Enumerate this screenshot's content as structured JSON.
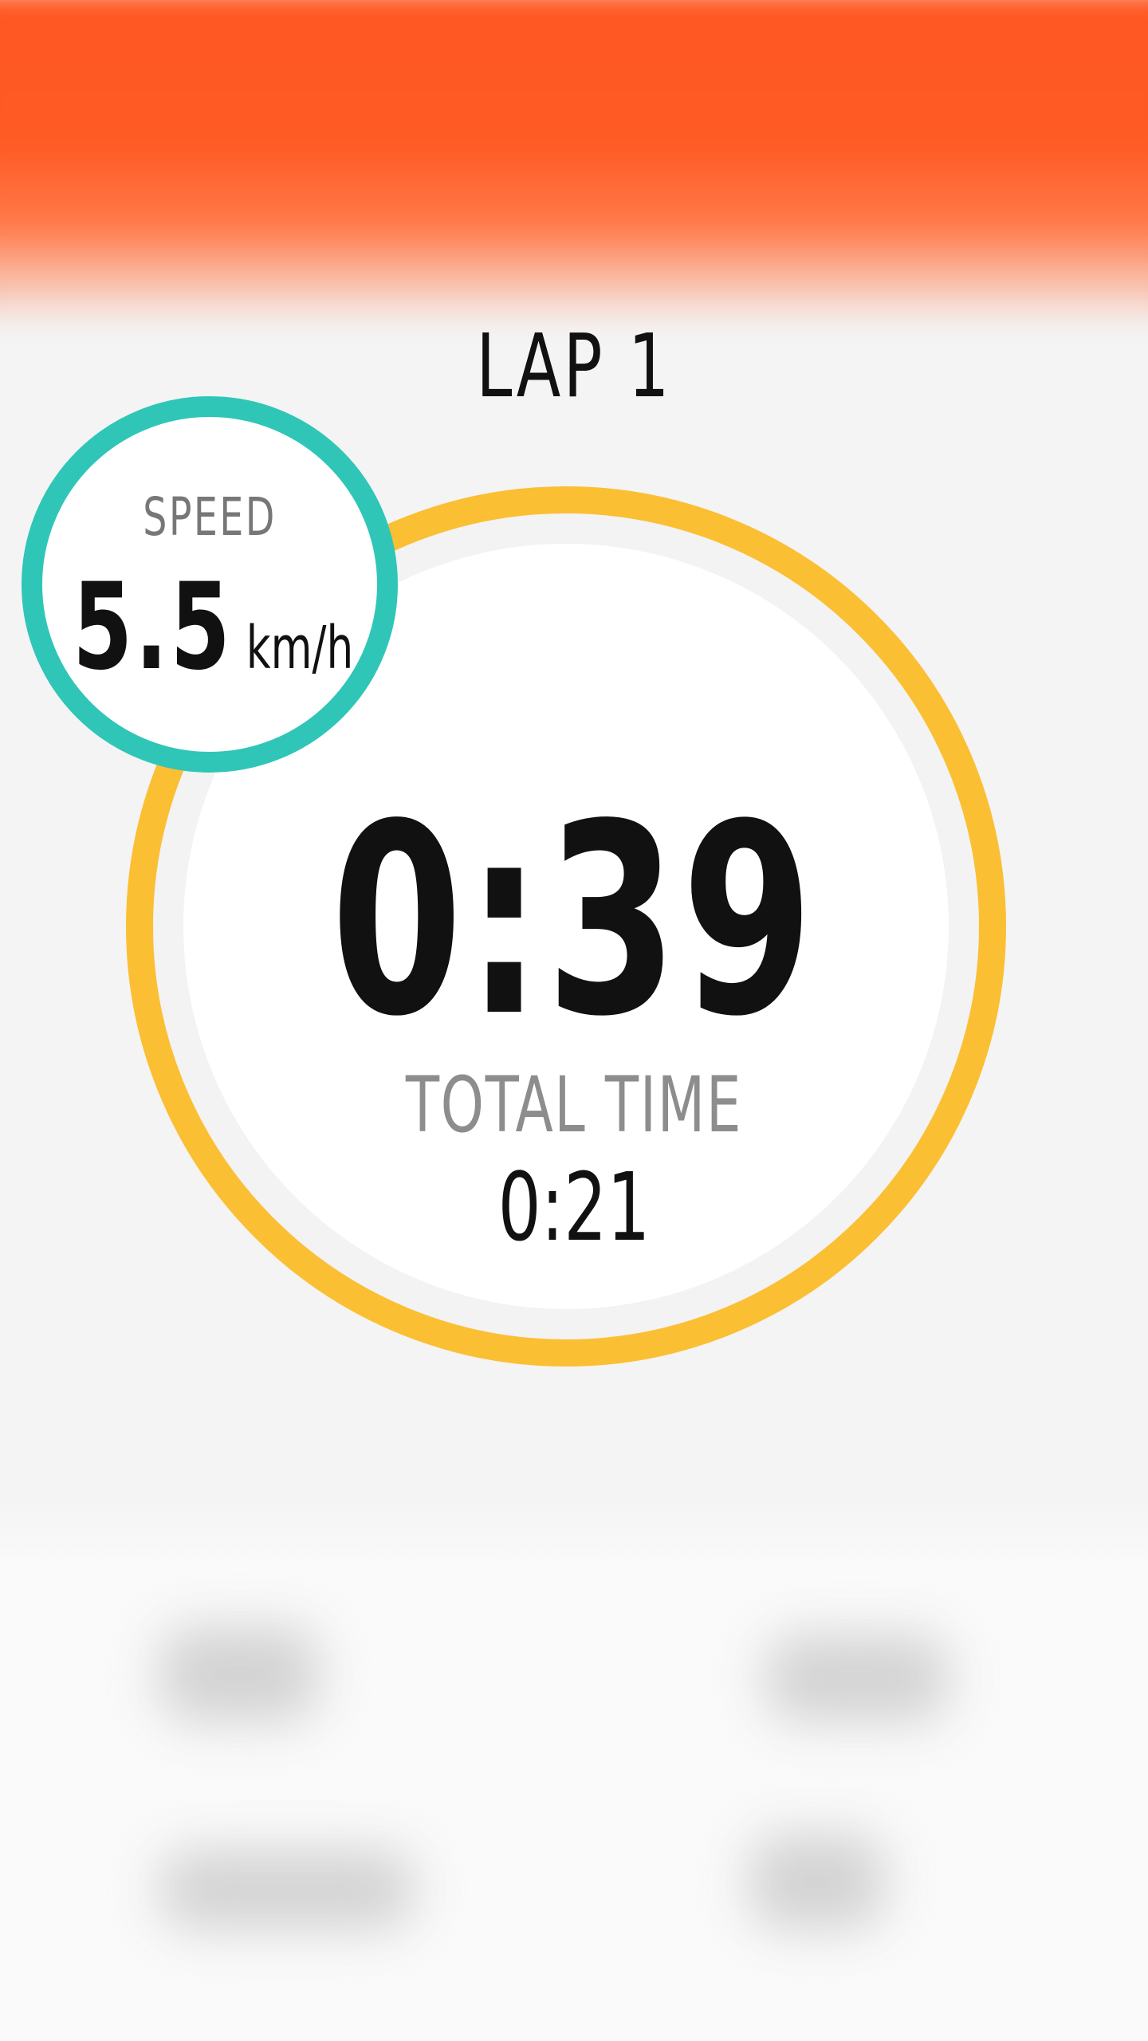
{
  "header": {
    "lap_title": "LAP 1",
    "accent_color": "#ff5722"
  },
  "timer": {
    "lap_time": "0:39",
    "total_label": "TOTAL TIME",
    "total_value": "0:21",
    "ring_color": "#fbbf34"
  },
  "speed": {
    "label": "SPEED",
    "value": "5.5",
    "unit": "km/h",
    "ring_color": "#2fc6b7"
  }
}
